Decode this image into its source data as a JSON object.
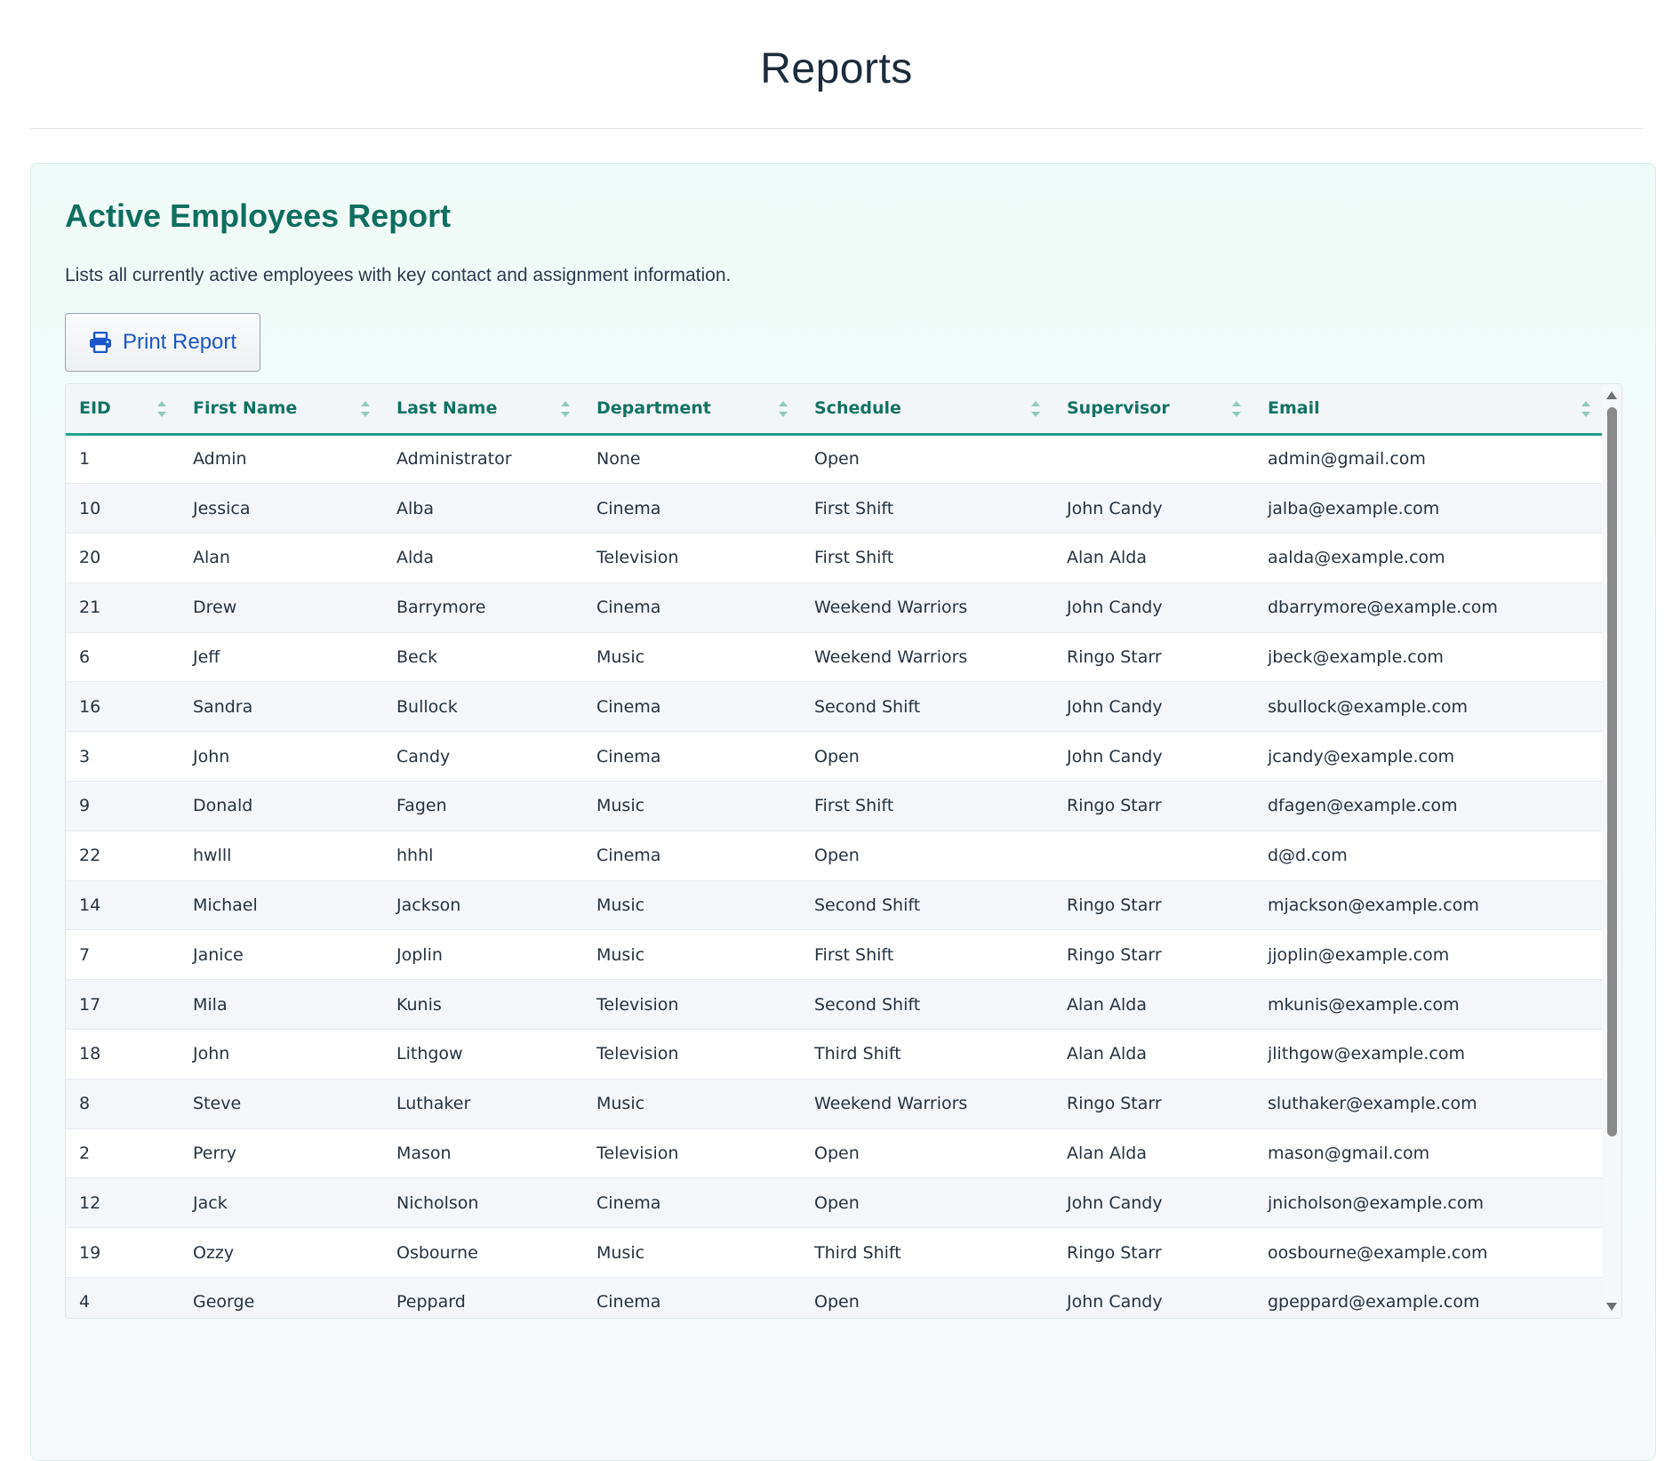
{
  "page": {
    "title": "Reports"
  },
  "report": {
    "title": "Active Employees Report",
    "description": "Lists all currently active employees with key contact and assignment information.",
    "print_label": "Print Report"
  },
  "table": {
    "columns": [
      "EID",
      "First Name",
      "Last Name",
      "Department",
      "Schedule",
      "Supervisor",
      "Email"
    ],
    "rows": [
      [
        "1",
        "Admin",
        "Administrator",
        "None",
        "Open",
        "",
        "admin@gmail.com"
      ],
      [
        "10",
        "Jessica",
        "Alba",
        "Cinema",
        "First Shift",
        "John Candy",
        "jalba@example.com"
      ],
      [
        "20",
        "Alan",
        "Alda",
        "Television",
        "First Shift",
        "Alan Alda",
        "aalda@example.com"
      ],
      [
        "21",
        "Drew",
        "Barrymore",
        "Cinema",
        "Weekend Warriors",
        "John Candy",
        "dbarrymore@example.com"
      ],
      [
        "6",
        "Jeff",
        "Beck",
        "Music",
        "Weekend Warriors",
        "Ringo Starr",
        "jbeck@example.com"
      ],
      [
        "16",
        "Sandra",
        "Bullock",
        "Cinema",
        "Second Shift",
        "John Candy",
        "sbullock@example.com"
      ],
      [
        "3",
        "John",
        "Candy",
        "Cinema",
        "Open",
        "John Candy",
        "jcandy@example.com"
      ],
      [
        "9",
        "Donald",
        "Fagen",
        "Music",
        "First Shift",
        "Ringo Starr",
        "dfagen@example.com"
      ],
      [
        "22",
        "hwlll",
        "hhhl",
        "Cinema",
        "Open",
        "",
        "d@d.com"
      ],
      [
        "14",
        "Michael",
        "Jackson",
        "Music",
        "Second Shift",
        "Ringo Starr",
        "mjackson@example.com"
      ],
      [
        "7",
        "Janice",
        "Joplin",
        "Music",
        "First Shift",
        "Ringo Starr",
        "jjoplin@example.com"
      ],
      [
        "17",
        "Mila",
        "Kunis",
        "Television",
        "Second Shift",
        "Alan Alda",
        "mkunis@example.com"
      ],
      [
        "18",
        "John",
        "Lithgow",
        "Television",
        "Third Shift",
        "Alan Alda",
        "jlithgow@example.com"
      ],
      [
        "8",
        "Steve",
        "Luthaker",
        "Music",
        "Weekend Warriors",
        "Ringo Starr",
        "sluthaker@example.com"
      ],
      [
        "2",
        "Perry",
        "Mason",
        "Television",
        "Open",
        "Alan Alda",
        "mason@gmail.com"
      ],
      [
        "12",
        "Jack",
        "Nicholson",
        "Cinema",
        "Open",
        "John Candy",
        "jnicholson@example.com"
      ],
      [
        "19",
        "Ozzy",
        "Osbourne",
        "Music",
        "Third Shift",
        "Ringo Starr",
        "oosbourne@example.com"
      ],
      [
        "4",
        "George",
        "Peppard",
        "Cinema",
        "Open",
        "John Candy",
        "gpeppard@example.com"
      ]
    ]
  },
  "colors": {
    "accent": "#137363",
    "header_border": "#22a08a",
    "link": "#1a56c8"
  },
  "icons": {
    "print": "printer-icon",
    "sort": "sort-icon",
    "scroll_up": "scroll-up-arrow-icon",
    "scroll_down": "scroll-down-arrow-icon"
  }
}
